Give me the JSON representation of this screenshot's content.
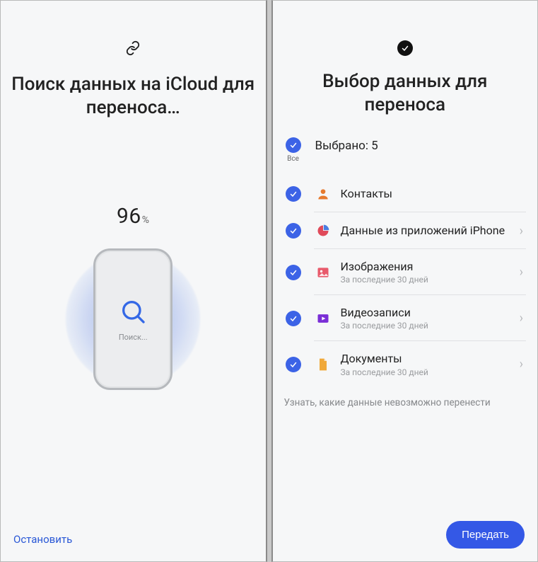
{
  "left": {
    "title": "Поиск данных на iCloud для\nпереноса…",
    "progress_value": "96",
    "progress_unit": "%",
    "phone_status": "Поиск...",
    "stop_label": "Остановить"
  },
  "right": {
    "title": "Выбор данных для\nпереноса",
    "all_label": "Все",
    "selected_summary": "Выбрано: 5",
    "items": [
      {
        "id": "contacts",
        "label": "Контакты",
        "sub": "",
        "has_chevron": false
      },
      {
        "id": "appdata",
        "label": "Данные из приложений iPhone",
        "sub": "",
        "has_chevron": true
      },
      {
        "id": "images",
        "label": "Изображения",
        "sub": "За последние 30 дней",
        "has_chevron": true
      },
      {
        "id": "videos",
        "label": "Видеозаписи",
        "sub": "За последние 30 дней",
        "has_chevron": true
      },
      {
        "id": "documents",
        "label": "Документы",
        "sub": "За последние 30 дней",
        "has_chevron": true
      }
    ],
    "cannot_transfer_label": "Узнать, какие данные невозможно перенести",
    "transfer_label": "Передать"
  },
  "colors": {
    "primary": "#3458e6",
    "check": "#3c63e6"
  }
}
